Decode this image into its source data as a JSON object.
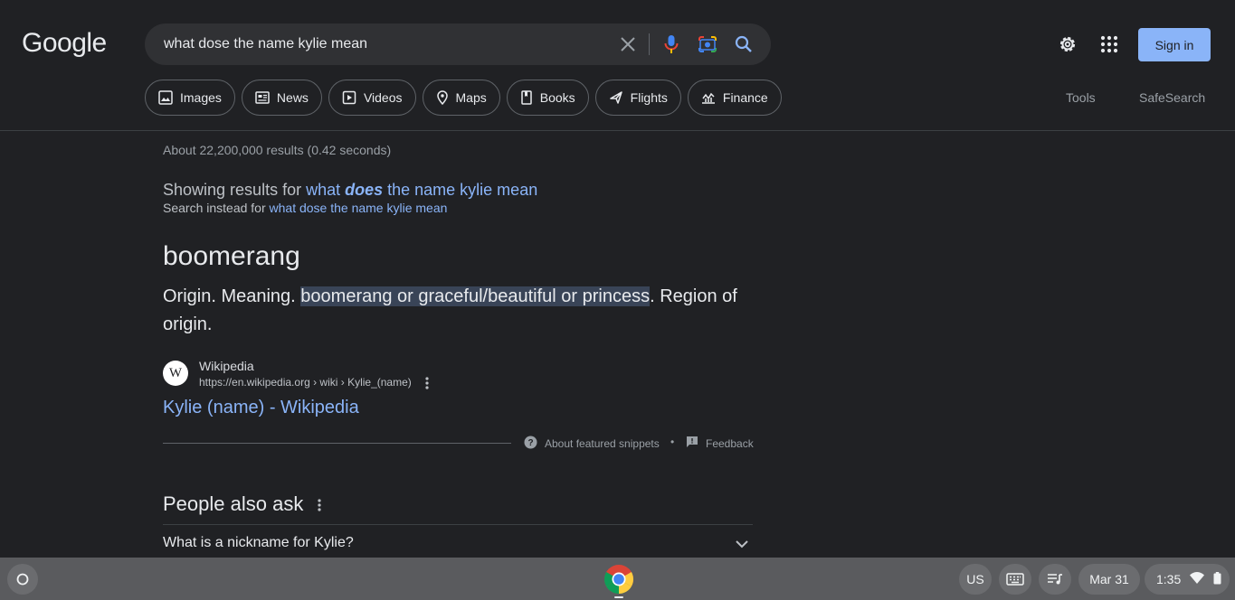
{
  "header": {
    "logo": "Google",
    "search_query": "what dose the name kylie mean",
    "signin_label": "Sign in"
  },
  "chips": [
    {
      "label": "Images",
      "icon": "image-icon"
    },
    {
      "label": "News",
      "icon": "news-icon"
    },
    {
      "label": "Videos",
      "icon": "video-icon"
    },
    {
      "label": "Maps",
      "icon": "map-pin-icon"
    },
    {
      "label": "Books",
      "icon": "book-icon"
    },
    {
      "label": "Flights",
      "icon": "plane-icon"
    },
    {
      "label": "Finance",
      "icon": "finance-icon"
    }
  ],
  "tools_label": "Tools",
  "safesearch_label": "SafeSearch",
  "results": {
    "stats": "About 22,200,000 results (0.42 seconds)",
    "showing_prefix": "Showing results for ",
    "corrected_part1": "what ",
    "corrected_bold": "does",
    "corrected_part2": " the name kylie mean",
    "instead_prefix": "Search instead for ",
    "instead_link": "what dose the name kylie mean"
  },
  "featured": {
    "title": "boomerang",
    "snippet_before": "Origin. Meaning. ",
    "snippet_highlight": "boomerang or graceful/beautiful or princess",
    "snippet_after": ". Region of origin.",
    "favicon_letter": "W",
    "source_name": "Wikipedia",
    "source_url": "https://en.wikipedia.org › wiki › Kylie_(name)",
    "link_title": "Kylie (name) - Wikipedia",
    "about_label": "About featured snippets",
    "separator": "•",
    "feedback_label": "Feedback"
  },
  "people_also_ask": {
    "title": "People also ask",
    "questions": [
      "What is a nickname for Kylie?"
    ]
  },
  "taskbar": {
    "lang": "US",
    "date": "Mar 31",
    "time": "1:35"
  },
  "colors": {
    "background": "#202124",
    "link": "#8ab4f8",
    "highlight": "#394457",
    "taskbar": "#5a5b5e"
  }
}
